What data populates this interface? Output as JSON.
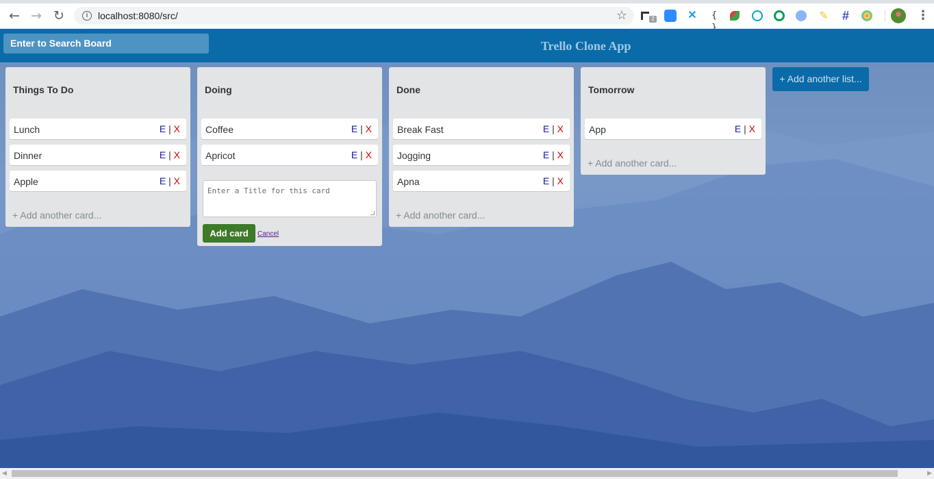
{
  "browser": {
    "url": "localhost:8080/src/",
    "ext_badge": "2",
    "ext_braces": "{ }"
  },
  "header": {
    "search_placeholder": "Enter to Search Board",
    "title": "Trello Clone App"
  },
  "card_actions": {
    "edit": "E",
    "sep": "|",
    "delete": "X"
  },
  "lists": [
    {
      "title": "Things To Do",
      "cards": [
        "Lunch",
        "Dinner",
        "Apple"
      ],
      "add_card": "+ Add another card..."
    },
    {
      "title": "Doing",
      "cards": [
        "Coffee",
        "Apricot"
      ],
      "input_placeholder": "Enter a Title for this card",
      "add_button": "Add card",
      "cancel": "Cancel"
    },
    {
      "title": "Done",
      "cards": [
        "Break Fast",
        "Jogging",
        "Apna"
      ],
      "add_card": "+ Add another card..."
    },
    {
      "title": "Tomorrow",
      "cards": [
        "App"
      ],
      "add_card": "+ Add another card..."
    }
  ],
  "add_list": "+ Add another list...",
  "colors": {
    "header": "#0a6ba8",
    "add_button": "#3e7a28",
    "edit_action": "#1a1aa6",
    "delete_action": "#d40000"
  }
}
